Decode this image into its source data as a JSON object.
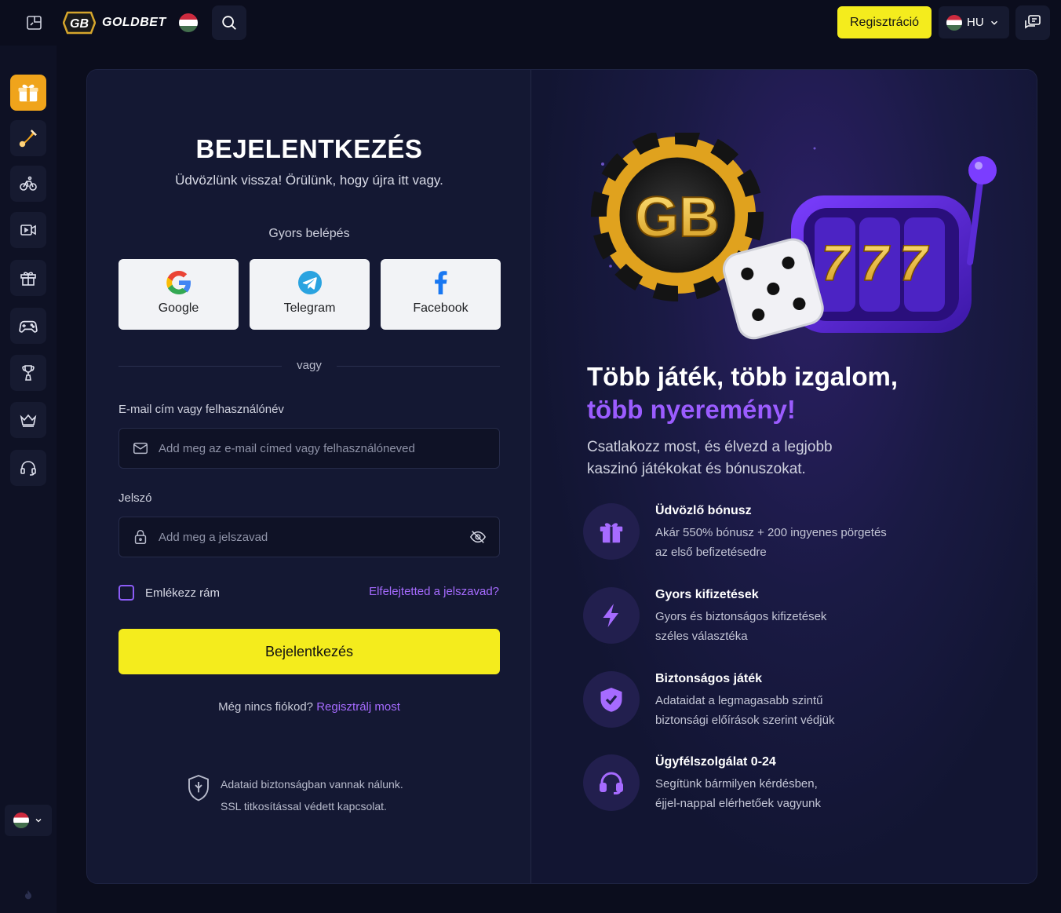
{
  "topbar": {
    "brand": "GOLDBET",
    "register_label": "Regisztráció",
    "language": "HU"
  },
  "sidebar": {
    "items": [
      {
        "icon": "gift-box-icon",
        "active": true
      },
      {
        "icon": "sports-icon"
      },
      {
        "icon": "cycling-icon"
      },
      {
        "icon": "live-video-icon"
      },
      {
        "icon": "gift-icon"
      },
      {
        "icon": "gamepad-icon"
      },
      {
        "icon": "trophy-icon"
      },
      {
        "icon": "crown-icon"
      },
      {
        "icon": "headset-icon"
      }
    ]
  },
  "login": {
    "title": "BEJELENTKEZÉS",
    "subtitle": "Üdvözlünk vissza! Örülünk, hogy újra itt vagy.",
    "quick_label": "Gyors belépés",
    "social": {
      "google": "Google",
      "telegram": "Telegram",
      "facebook": "Facebook"
    },
    "divider": "vagy",
    "email_label": "E-mail cím vagy felhasználónév",
    "email_placeholder": "Add meg az e-mail címed vagy felhasználóneved",
    "password_label": "Jelszó",
    "password_placeholder": "Add meg a jelszavad",
    "remember_label": "Emlékezz rám",
    "forgot_label": "Elfelejtetted a jelszavad?",
    "submit_label": "Bejelentkezés",
    "no_account_text": "Még nincs fiókod?",
    "register_link": "Regisztrálj most",
    "secure_line1": "Adataid biztonságban vannak nálunk.",
    "secure_line2": "SSL titkosítással védett kapcsolat."
  },
  "promo": {
    "title_line1": "Több játék, több izgalom,",
    "title_line2": "több nyeremény!",
    "subtitle": "Csatlakozz most, és élvezd a legjobb kaszinó játékokat és bónuszokat.",
    "hero": {
      "chip_text": "GB",
      "slot_text": "777"
    },
    "features": [
      {
        "icon": "gift-icon",
        "title": "Üdvözlő bónusz",
        "desc1": "Akár 550% bónusz + 200 ingyenes pörgetés",
        "desc2": "az első befizetésedre"
      },
      {
        "icon": "lightning-icon",
        "title": "Gyors kifizetések",
        "desc1": "Gyors és biztonságos kifizetések",
        "desc2": "széles választéka"
      },
      {
        "icon": "shield-check-icon",
        "title": "Biztonságos játék",
        "desc1": "Adataidat a legmagasabb szintű",
        "desc2": "biztonsági előírások szerint védjük"
      },
      {
        "icon": "headset-icon",
        "title": "Ügyfélszolgálat 0-24",
        "desc1": "Segítünk bármilyen kérdésben,",
        "desc2": "éjjel-nappal elérhetőek vagyunk"
      }
    ]
  },
  "colors": {
    "accent_yellow": "#f4ec1d",
    "accent_purple": "#9b5cff",
    "background": "#0b0d1d"
  }
}
